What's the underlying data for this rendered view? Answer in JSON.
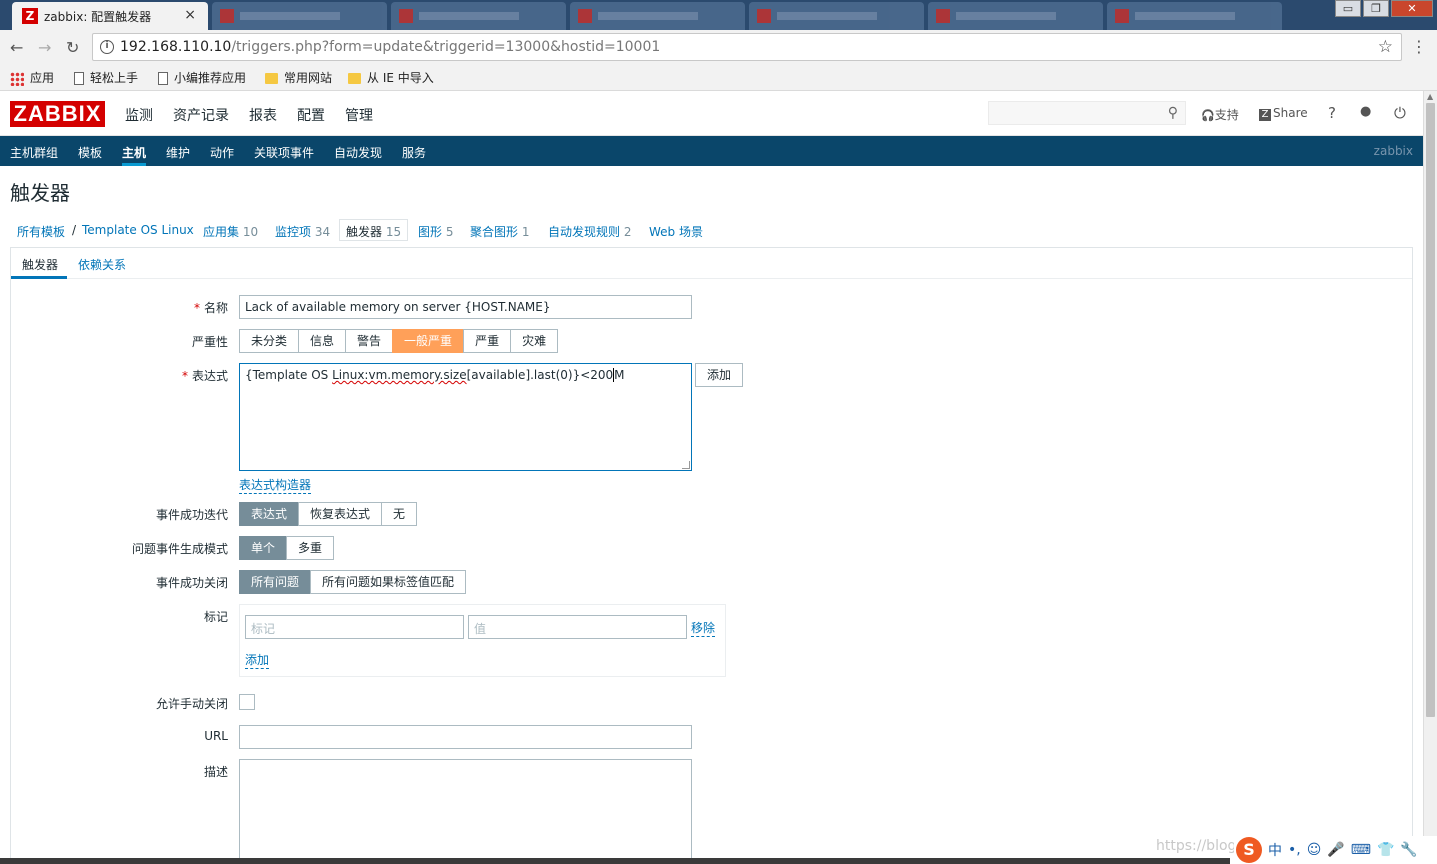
{
  "browser": {
    "active_tab": {
      "favicon": "Z",
      "title": "zabbix: 配置触发器",
      "close": "×"
    },
    "window_buttons": {
      "minimize": "▭",
      "restore": "❐",
      "close": "✕"
    },
    "url_host": "192.168.110.10",
    "url_path": "/triggers.php?form=update&triggerid=13000&hostid=10001",
    "icons": {
      "back": "back-arrow-icon",
      "forward": "forward-arrow-icon",
      "reload": "reload-icon",
      "info": "info-icon",
      "star": "star-icon",
      "menu": "menu-icon"
    },
    "glyphs": {
      "back": "←",
      "forward": "→",
      "reload": "↻",
      "info": "i",
      "star": "☆",
      "menu": "⋮"
    },
    "bookmarks": [
      "应用",
      "轻松上手",
      "小编推荐应用",
      "常用网站",
      "从 IE 中导入"
    ]
  },
  "header": {
    "logo": "ZABBIX",
    "menu": [
      "监测",
      "资产记录",
      "报表",
      "配置",
      "管理"
    ],
    "search_placeholder": "",
    "search_glyph": "⚲",
    "support": "支持",
    "share": "Share",
    "help": "?",
    "user_glyph": "●",
    "power_glyph": "⏻",
    "support_glyph": "🎧",
    "share_glyph": "Z"
  },
  "subnav": {
    "items": [
      "主机群组",
      "模板",
      "主机",
      "维护",
      "动作",
      "关联项事件",
      "自动发现",
      "服务"
    ],
    "user": "zabbix"
  },
  "page": {
    "title": "触发器",
    "breadcrumbs": {
      "all_templates": "所有模板",
      "sep": "/",
      "template": "Template OS Linux",
      "apps": "应用集",
      "apps_count": "10",
      "items": "监控项",
      "items_count": "34",
      "triggers": "触发器",
      "triggers_count": "15",
      "graphs": "图形",
      "graphs_count": "5",
      "screens": "聚合图形",
      "screens_count": "1",
      "discovery": "自动发现规则",
      "discovery_count": "2",
      "web": "Web 场景"
    }
  },
  "form": {
    "tabs": [
      "触发器",
      "依赖关系"
    ],
    "name_label": "名称",
    "name_value": "Lack of available memory on server {HOST.NAME}",
    "severity_label": "严重性",
    "severities": [
      "未分类",
      "信息",
      "警告",
      "一般严重",
      "严重",
      "灾难"
    ],
    "severity_selected": "一般严重",
    "expression_label": "表达式",
    "expression_parts": {
      "a": "{Template OS ",
      "b": "Linux:vm.memory.size",
      "c": "[available].last(0)}<200",
      "d": "M"
    },
    "add_button": "添加",
    "expression_builder": "表达式构造器",
    "ok_event_label": "事件成功迭代",
    "ok_event_options": [
      "表达式",
      "恢复表达式",
      "无"
    ],
    "problem_mode_label": "问题事件生成模式",
    "problem_mode_options": [
      "单个",
      "多重"
    ],
    "ok_close_label": "事件成功关闭",
    "ok_close_options": [
      "所有问题",
      "所有问题如果标签值匹配"
    ],
    "tags_label": "标记",
    "tag_placeholder": "标记",
    "value_placeholder": "值",
    "remove_link": "移除",
    "add_link": "添加",
    "manual_close_label": "允许手动关闭",
    "url_label": "URL",
    "url_value": "",
    "description_label": "描述",
    "description_value": ""
  },
  "watermark": "https://blog",
  "ime": {
    "logo": "S",
    "items": [
      "中",
      "•,",
      "☺",
      "🎤",
      "⌨",
      "👕",
      "🔧"
    ]
  },
  "colors": {
    "brand": "#d40000",
    "subnav": "#0a466a",
    "severity_average": "#ffa059",
    "link": "#0275b8",
    "segment_on": "#768d99"
  }
}
